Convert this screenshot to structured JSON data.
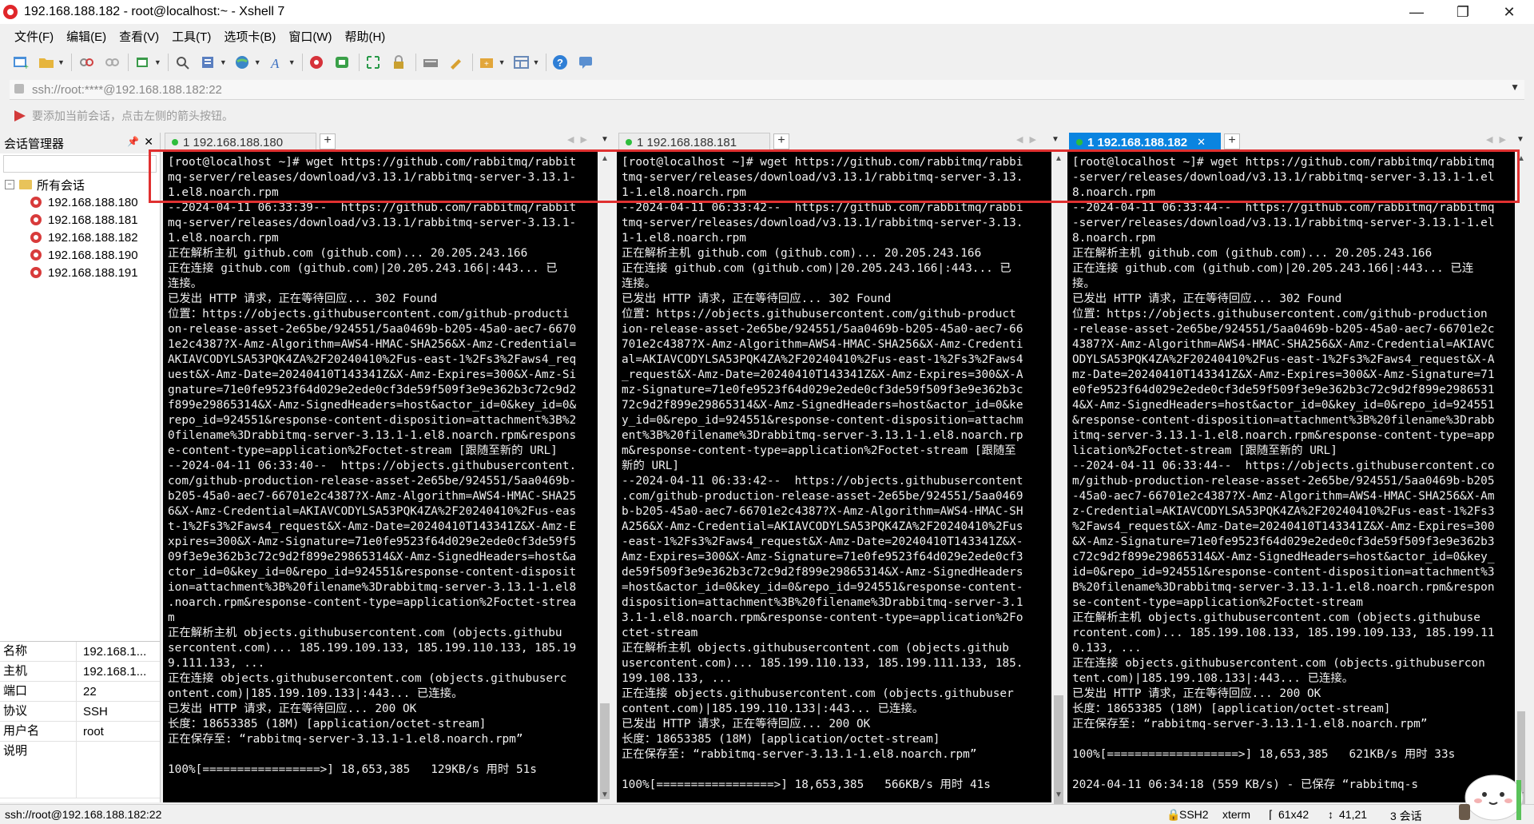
{
  "window": {
    "title": "192.168.188.182 - root@localhost:~ - Xshell 7",
    "minimize": "—",
    "maximize": "❐",
    "close": "✕"
  },
  "menu": [
    "文件(F)",
    "编辑(E)",
    "查看(V)",
    "工具(T)",
    "选项卡(B)",
    "窗口(W)",
    "帮助(H)"
  ],
  "toolbar_icons": [
    "new-session-icon",
    "open-folder-icon",
    "disconnect-icon",
    "reconnect-icon",
    "new-tab-icon",
    "search-icon",
    "properties-icon",
    "globe-icon",
    "font-icon",
    "xftp-icon",
    "xshell-icon",
    "fullscreen-icon",
    "lock-icon",
    "keyboard-icon",
    "highlighter-icon",
    "compose-icon",
    "layout-icon",
    "help-icon",
    "chat-icon"
  ],
  "address": {
    "text": "ssh://root:****@192.168.188.182:22"
  },
  "hint": "要添加当前会话，点击左侧的箭头按钮。",
  "sessions": {
    "header": "会话管理器",
    "root": "所有会话",
    "items": [
      "192.168.188.180",
      "192.168.188.181",
      "192.168.188.182",
      "192.168.188.190",
      "192.168.188.191"
    ]
  },
  "properties": [
    {
      "key": "名称",
      "value": "192.168.1..."
    },
    {
      "key": "主机",
      "value": "192.168.1..."
    },
    {
      "key": "端口",
      "value": "22"
    },
    {
      "key": "协议",
      "value": "SSH"
    },
    {
      "key": "用户名",
      "value": "root"
    },
    {
      "key": "说明",
      "value": ""
    }
  ],
  "panes": [
    {
      "tab": "1 192.168.188.180",
      "active": false,
      "lines": [
        "[root@localhost ~]# wget https://github.com/rabbitmq/rabbit",
        "mq-server/releases/download/v3.13.1/rabbitmq-server-3.13.1-",
        "1.el8.noarch.rpm",
        "--2024-04-11 06:33:39--  https://github.com/rabbitmq/rabbit",
        "mq-server/releases/download/v3.13.1/rabbitmq-server-3.13.1-",
        "1.el8.noarch.rpm",
        "正在解析主机 github.com (github.com)... 20.205.243.166",
        "正在连接 github.com (github.com)|20.205.243.166|:443... 已",
        "连接。",
        "已发出 HTTP 请求，正在等待回应... 302 Found",
        "位置：https://objects.githubusercontent.com/github-producti",
        "on-release-asset-2e65be/924551/5aa0469b-b205-45a0-aec7-6670",
        "1e2c4387?X-Amz-Algorithm=AWS4-HMAC-SHA256&X-Amz-Credential=",
        "AKIAVCODYLSA53PQK4ZA%2F20240410%2Fus-east-1%2Fs3%2Faws4_req",
        "uest&X-Amz-Date=20240410T143341Z&X-Amz-Expires=300&X-Amz-Si",
        "gnature=71e0fe9523f64d029e2ede0cf3de59f509f3e9e362b3c72c9d2",
        "f899e29865314&X-Amz-SignedHeaders=host&actor_id=0&key_id=0&",
        "repo_id=924551&response-content-disposition=attachment%3B%2",
        "0filename%3Drabbitmq-server-3.13.1-1.el8.noarch.rpm&respons",
        "e-content-type=application%2Foctet-stream [跟随至新的 URL]",
        "--2024-04-11 06:33:40--  https://objects.githubusercontent.",
        "com/github-production-release-asset-2e65be/924551/5aa0469b-",
        "b205-45a0-aec7-66701e2c4387?X-Amz-Algorithm=AWS4-HMAC-SHA25",
        "6&X-Amz-Credential=AKIAVCODYLSA53PQK4ZA%2F20240410%2Fus-eas",
        "t-1%2Fs3%2Faws4_request&X-Amz-Date=20240410T143341Z&X-Amz-E",
        "xpires=300&X-Amz-Signature=71e0fe9523f64d029e2ede0cf3de59f5",
        "09f3e9e362b3c72c9d2f899e29865314&X-Amz-SignedHeaders=host&a",
        "ctor_id=0&key_id=0&repo_id=924551&response-content-disposit",
        "ion=attachment%3B%20filename%3Drabbitmq-server-3.13.1-1.el8",
        ".noarch.rpm&response-content-type=application%2Foctet-strea",
        "m",
        "正在解析主机 objects.githubusercontent.com (objects.githubu",
        "sercontent.com)... 185.199.109.133, 185.199.110.133, 185.19",
        "9.111.133, ...",
        "正在连接 objects.githubusercontent.com (objects.githubuserc",
        "ontent.com)|185.199.109.133|:443... 已连接。",
        "已发出 HTTP 请求，正在等待回应... 200 OK",
        "长度：18653385 (18M) [application/octet-stream]",
        "正在保存至: “rabbitmq-server-3.13.1-1.el8.noarch.rpm”",
        "",
        "100%[=================>] 18,653,385   129KB/s 用时 51s"
      ]
    },
    {
      "tab": "1 192.168.188.181",
      "active": false,
      "lines": [
        "[root@localhost ~]# wget https://github.com/rabbitmq/rabbi",
        "tmq-server/releases/download/v3.13.1/rabbitmq-server-3.13.",
        "1-1.el8.noarch.rpm",
        "--2024-04-11 06:33:42--  https://github.com/rabbitmq/rabbi",
        "tmq-server/releases/download/v3.13.1/rabbitmq-server-3.13.",
        "1-1.el8.noarch.rpm",
        "正在解析主机 github.com (github.com)... 20.205.243.166",
        "正在连接 github.com (github.com)|20.205.243.166|:443... 已",
        "连接。",
        "已发出 HTTP 请求，正在等待回应... 302 Found",
        "位置：https://objects.githubusercontent.com/github-product",
        "ion-release-asset-2e65be/924551/5aa0469b-b205-45a0-aec7-66",
        "701e2c4387?X-Amz-Algorithm=AWS4-HMAC-SHA256&X-Amz-Credenti",
        "al=AKIAVCODYLSA53PQK4ZA%2F20240410%2Fus-east-1%2Fs3%2Faws4",
        "_request&X-Amz-Date=20240410T143341Z&X-Amz-Expires=300&X-A",
        "mz-Signature=71e0fe9523f64d029e2ede0cf3de59f509f3e9e362b3c",
        "72c9d2f899e29865314&X-Amz-SignedHeaders=host&actor_id=0&ke",
        "y_id=0&repo_id=924551&response-content-disposition=attachm",
        "ent%3B%20filename%3Drabbitmq-server-3.13.1-1.el8.noarch.rp",
        "m&response-content-type=application%2Foctet-stream [跟随至",
        "新的 URL]",
        "--2024-04-11 06:33:42--  https://objects.githubusercontent",
        ".com/github-production-release-asset-2e65be/924551/5aa0469",
        "b-b205-45a0-aec7-66701e2c4387?X-Amz-Algorithm=AWS4-HMAC-SH",
        "A256&X-Amz-Credential=AKIAVCODYLSA53PQK4ZA%2F20240410%2Fus",
        "-east-1%2Fs3%2Faws4_request&X-Amz-Date=20240410T143341Z&X-",
        "Amz-Expires=300&X-Amz-Signature=71e0fe9523f64d029e2ede0cf3",
        "de59f509f3e9e362b3c72c9d2f899e29865314&X-Amz-SignedHeaders",
        "=host&actor_id=0&key_id=0&repo_id=924551&response-content-",
        "disposition=attachment%3B%20filename%3Drabbitmq-server-3.1",
        "3.1-1.el8.noarch.rpm&response-content-type=application%2Fo",
        "ctet-stream",
        "正在解析主机 objects.githubusercontent.com (objects.github",
        "usercontent.com)... 185.199.110.133, 185.199.111.133, 185.",
        "199.108.133, ...",
        "正在连接 objects.githubusercontent.com (objects.githubuser",
        "content.com)|185.199.110.133|:443... 已连接。",
        "已发出 HTTP 请求，正在等待回应... 200 OK",
        "长度：18653385 (18M) [application/octet-stream]",
        "正在保存至: “rabbitmq-server-3.13.1-1.el8.noarch.rpm”",
        "",
        "100%[=================>] 18,653,385   566KB/s 用时 41s"
      ]
    },
    {
      "tab": "1 192.168.188.182",
      "active": true,
      "lines": [
        "[root@localhost ~]# wget https://github.com/rabbitmq/rabbitmq",
        "-server/releases/download/v3.13.1/rabbitmq-server-3.13.1-1.el",
        "8.noarch.rpm",
        "--2024-04-11 06:33:44--  https://github.com/rabbitmq/rabbitmq",
        "-server/releases/download/v3.13.1/rabbitmq-server-3.13.1-1.el",
        "8.noarch.rpm",
        "正在解析主机 github.com (github.com)... 20.205.243.166",
        "正在连接 github.com (github.com)|20.205.243.166|:443... 已连",
        "接。",
        "已发出 HTTP 请求，正在等待回应... 302 Found",
        "位置：https://objects.githubusercontent.com/github-production",
        "-release-asset-2e65be/924551/5aa0469b-b205-45a0-aec7-66701e2c",
        "4387?X-Amz-Algorithm=AWS4-HMAC-SHA256&X-Amz-Credential=AKIAVC",
        "ODYLSA53PQK4ZA%2F20240410%2Fus-east-1%2Fs3%2Faws4_request&X-A",
        "mz-Date=20240410T143341Z&X-Amz-Expires=300&X-Amz-Signature=71",
        "e0fe9523f64d029e2ede0cf3de59f509f3e9e362b3c72c9d2f899e2986531",
        "4&X-Amz-SignedHeaders=host&actor_id=0&key_id=0&repo_id=924551",
        "&response-content-disposition=attachment%3B%20filename%3Drabb",
        "itmq-server-3.13.1-1.el8.noarch.rpm&response-content-type=app",
        "lication%2Foctet-stream [跟随至新的 URL]",
        "--2024-04-11 06:33:44--  https://objects.githubusercontent.co",
        "m/github-production-release-asset-2e65be/924551/5aa0469b-b205",
        "-45a0-aec7-66701e2c4387?X-Amz-Algorithm=AWS4-HMAC-SHA256&X-Am",
        "z-Credential=AKIAVCODYLSA53PQK4ZA%2F20240410%2Fus-east-1%2Fs3",
        "%2Faws4_request&X-Amz-Date=20240410T143341Z&X-Amz-Expires=300",
        "&X-Amz-Signature=71e0fe9523f64d029e2ede0cf3de59f509f3e9e362b3",
        "c72c9d2f899e29865314&X-Amz-SignedHeaders=host&actor_id=0&key_",
        "id=0&repo_id=924551&response-content-disposition=attachment%3",
        "B%20filename%3Drabbitmq-server-3.13.1-1.el8.noarch.rpm&respon",
        "se-content-type=application%2Foctet-stream",
        "正在解析主机 objects.githubusercontent.com (objects.githubuse",
        "rcontent.com)... 185.199.108.133, 185.199.109.133, 185.199.11",
        "0.133, ...",
        "正在连接 objects.githubusercontent.com (objects.githubusercon",
        "tent.com)|185.199.108.133|:443... 已连接。",
        "已发出 HTTP 请求，正在等待回应... 200 OK",
        "长度：18653385 (18M) [application/octet-stream]",
        "正在保存至: “rabbitmq-server-3.13.1-1.el8.noarch.rpm”",
        "",
        "100%[===================>] 18,653,385   621KB/s 用时 33s",
        "",
        "2024-04-11 06:34:18 (559 KB/s) - 已保存 “rabbitmq-s"
      ]
    }
  ],
  "status": {
    "left": "ssh://root@192.168.188.182:22",
    "protocol": "SSH2",
    "terminal": "xterm",
    "size": "61x42",
    "cursor": "41,21",
    "sessions": "3 会话"
  },
  "colors": {
    "active_tab": "#0a84e0",
    "highlight_box": "#e03030",
    "terminal_bg": "#000000",
    "terminal_fg": "#f0f0f0"
  }
}
